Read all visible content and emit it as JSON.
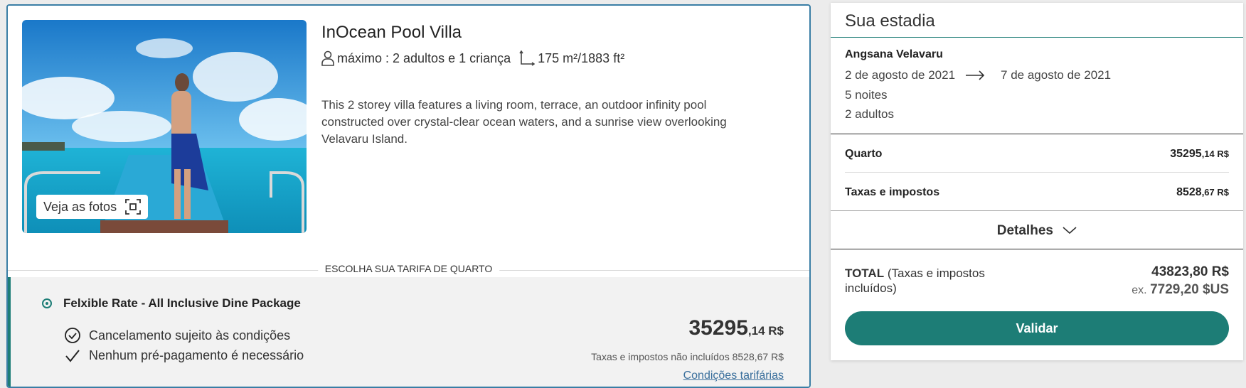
{
  "room": {
    "title": "InOcean Pool Villa",
    "capacity": "máximo : 2 adultos e 1 criança",
    "area": "175 m²/1883 ft²",
    "description": "This 2 storey villa features a living room, terrace, an outdoor infinity pool constructed over crystal-clear ocean waters, and a sunrise view overlooking Velavaru Island.",
    "photos_button": "Veja as fotos"
  },
  "rate_section_label": "ESCOLHA SUA TARIFA DE QUARTO",
  "rate": {
    "name": "Felxible Rate - All Inclusive Dine Package",
    "conditions": [
      "Cancelamento sujeito às condições",
      "Nenhum pré-pagamento é necessário"
    ],
    "price_whole": "35295",
    "price_cents": ",14 R$",
    "tax_note": "Taxas e impostos não incluídos 8528,67 R$",
    "terms_link": "Condições tarifárias"
  },
  "stay": {
    "title": "Sua estadia",
    "hotel": "Angsana Velavaru",
    "checkin": "2 de agosto de 2021",
    "checkout": "7 de agosto de 2021",
    "nights": "5 noites",
    "guests": "2 adultos",
    "room_label": "Quarto",
    "room_whole": "35295",
    "room_cents": ",14 R$",
    "taxes_label": "Taxas e impostos",
    "taxes_whole": "8528",
    "taxes_cents": ",67 R$",
    "details_label": "Detalhes",
    "total_label": "TOTAL",
    "total_note": "(Taxas e impostos incluídos)",
    "total_amount": "43823,80 R$",
    "usd_prefix": "ex.",
    "usd_amount": "7729,20 $US",
    "validate_button": "Validar"
  },
  "colors": {
    "accent": "#1d7d76",
    "card_border": "#3a7ea5",
    "link": "#3a6f9c"
  },
  "icons": [
    "user-icon",
    "area-icon",
    "expand-photos-icon",
    "clock-icon",
    "check-icon",
    "arrow-right-icon",
    "chevron-down-icon"
  ]
}
